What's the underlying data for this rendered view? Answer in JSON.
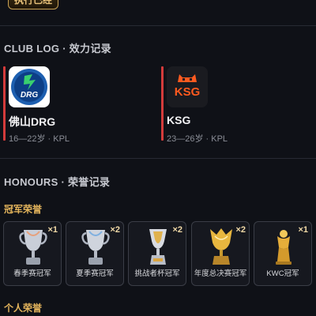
{
  "top_button": {
    "label": "执行已经"
  },
  "club_log": {
    "title": "CLUB LOG · 效力记录",
    "clubs": [
      {
        "name": "佛山DRG",
        "meta": "16—22岁 · KPL",
        "logo_text": "DRG",
        "logo_bg": "#1d5fb0"
      },
      {
        "name": "KSG",
        "meta": "23—26岁 · KPL",
        "logo_text": "KSG",
        "logo_bg": "#ff5a1f"
      }
    ]
  },
  "honours": {
    "title": "HONOURS · 荣誉记录",
    "champion_title": "冠军荣誉",
    "trophies": [
      {
        "label": "春季赛冠军",
        "count": "×1",
        "icon": "silver-trophy-icon"
      },
      {
        "label": "夏季赛冠军",
        "count": "×2",
        "icon": "silver-trophy-icon"
      },
      {
        "label": "挑战者杯冠军",
        "count": "×2",
        "icon": "silver-gold-trophy-icon"
      },
      {
        "label": "年度总决赛冠军",
        "count": "×2",
        "icon": "gold-trophy-icon"
      },
      {
        "label": "KWC冠军",
        "count": "×1",
        "icon": "gold-cup-icon"
      }
    ],
    "personal_title": "个人荣誉"
  },
  "colors": {
    "accent_gold": "#e3b45c",
    "club_bar": "#d43b3b",
    "background": "#0f1117"
  }
}
